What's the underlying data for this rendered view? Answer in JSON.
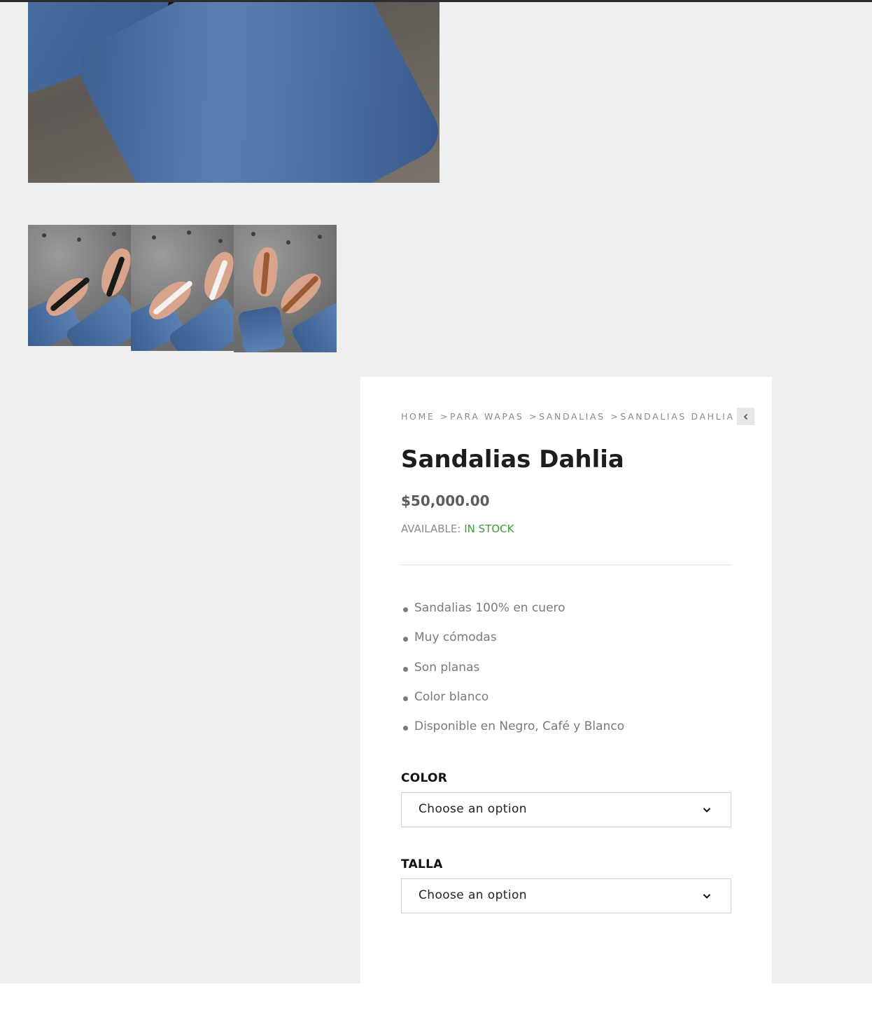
{
  "gallery": {
    "main_image_alt": "",
    "thumbnails": [
      {
        "name": "black",
        "sandal_color": "#1a1a1a"
      },
      {
        "name": "white",
        "sandal_color": "#f2f2f2"
      },
      {
        "name": "brown",
        "sandal_color": "#9a5a34"
      }
    ]
  },
  "product": {
    "breadcrumb": {
      "home": "HOME",
      "sep": ">",
      "cat1": "PARA WAPAS",
      "cat2": "SANDALIAS",
      "current": "SANDALIAS DAHLIA"
    },
    "back_icon": "chevron-left-icon",
    "title": "Sandalias Dahlia",
    "price": "$50,000.00",
    "availability_label": "AVAILABLE:",
    "availability_value": "IN STOCK",
    "features": [
      "Sandalias 100% en cuero",
      "Muy cómodas",
      "Son planas",
      "Color blanco",
      "Disponible en Negro, Café y Blanco"
    ],
    "color_label": "COLOR",
    "color_select": "Choose an option",
    "talla_label": "TALLA",
    "talla_select": "Choose an option"
  },
  "colors": {
    "in_stock": "#3a9a3a",
    "background": "#efefef",
    "card": "#ffffff"
  }
}
